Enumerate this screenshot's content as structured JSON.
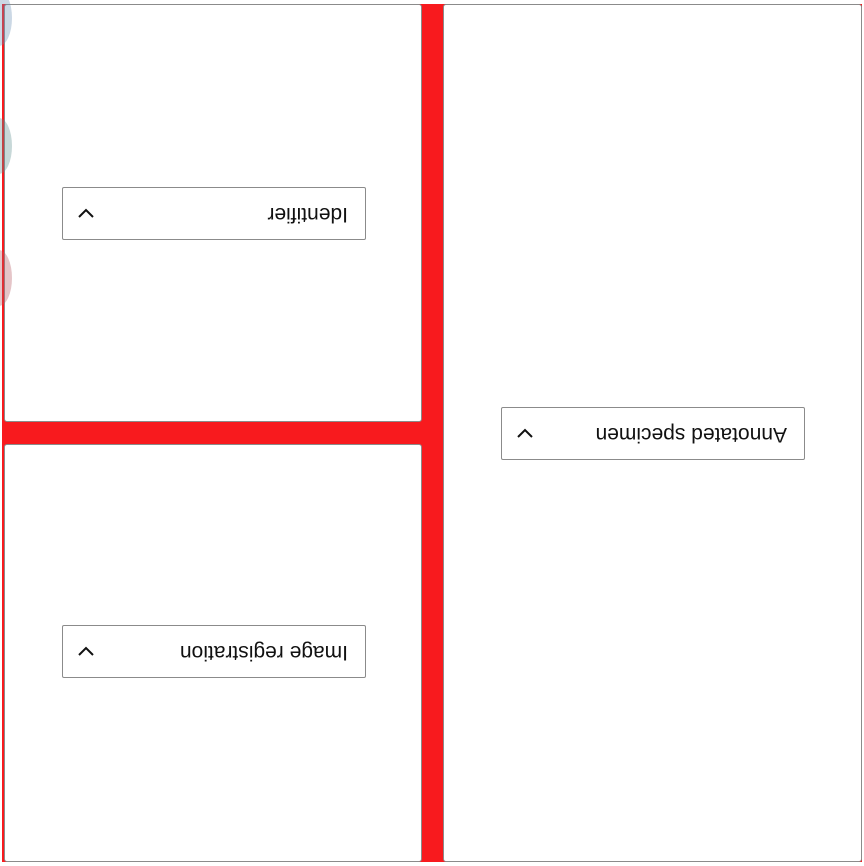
{
  "dropdowns": {
    "annotated": {
      "value": "Annotated specimen"
    },
    "image_registration": {
      "value": "Image registration"
    },
    "identifier": {
      "value": "Identifier"
    }
  },
  "icons": {
    "dropdown_chevron": "chevron-down-icon"
  },
  "colors": {
    "divider": "#f81a1e",
    "panel_border": "#8b8b8b",
    "background": "#ffffff"
  }
}
